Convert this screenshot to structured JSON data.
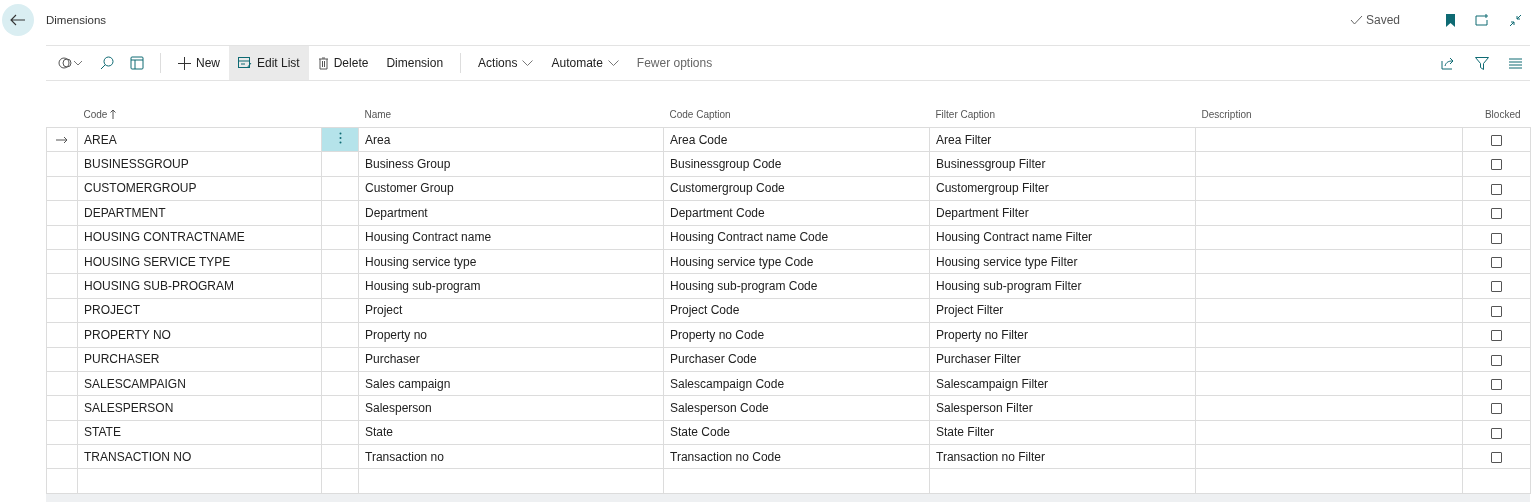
{
  "page": {
    "title": "Dimensions",
    "status": "Saved"
  },
  "toolbar": [
    {
      "label": "New",
      "kind": "new",
      "selected": false
    },
    {
      "label": "Edit List",
      "kind": "edit",
      "selected": true
    },
    {
      "label": "Delete",
      "kind": "delete",
      "selected": false
    },
    {
      "label": "Dimension",
      "kind": "plain",
      "selected": false
    },
    {
      "label": "Actions",
      "kind": "menu",
      "selected": false
    },
    {
      "label": "Automate",
      "kind": "menu",
      "selected": false
    },
    {
      "label": "Fewer options",
      "kind": "link",
      "selected": false
    }
  ],
  "table": {
    "columns": [
      "Code",
      "Name",
      "Code Caption",
      "Filter Caption",
      "Description",
      "Blocked"
    ],
    "rows": [
      {
        "code": "AREA",
        "name": "Area",
        "code_caption": "Area Code",
        "filter_caption": "Area Filter",
        "blocked": false,
        "selected": true
      },
      {
        "code": "BUSINESSGROUP",
        "name": "Business Group",
        "code_caption": "Businessgroup Code",
        "filter_caption": "Businessgroup Filter",
        "blocked": false,
        "selected": false
      },
      {
        "code": "CUSTOMERGROUP",
        "name": "Customer Group",
        "code_caption": "Customergroup Code",
        "filter_caption": "Customergroup Filter",
        "blocked": false,
        "selected": false
      },
      {
        "code": "DEPARTMENT",
        "name": "Department",
        "code_caption": "Department Code",
        "filter_caption": "Department Filter",
        "blocked": false,
        "selected": false
      },
      {
        "code": "HOUSING CONTRACTNAME",
        "name": "Housing Contract name",
        "code_caption": "Housing Contract name Code",
        "filter_caption": "Housing Contract name Filter",
        "blocked": false,
        "selected": false
      },
      {
        "code": "HOUSING SERVICE TYPE",
        "name": "Housing service type",
        "code_caption": "Housing service type Code",
        "filter_caption": "Housing service type Filter",
        "blocked": false,
        "selected": false
      },
      {
        "code": "HOUSING SUB-PROGRAM",
        "name": "Housing sub-program",
        "code_caption": "Housing sub-program Code",
        "filter_caption": "Housing sub-program Filter",
        "blocked": false,
        "selected": false
      },
      {
        "code": "PROJECT",
        "name": "Project",
        "code_caption": "Project Code",
        "filter_caption": "Project Filter",
        "blocked": false,
        "selected": false
      },
      {
        "code": "PROPERTY NO",
        "name": "Property no",
        "code_caption": "Property no Code",
        "filter_caption": "Property no Filter",
        "blocked": false,
        "selected": false
      },
      {
        "code": "PURCHASER",
        "name": "Purchaser",
        "code_caption": "Purchaser Code",
        "filter_caption": "Purchaser Filter",
        "blocked": false,
        "selected": false
      },
      {
        "code": "SALESCAMPAIGN",
        "name": "Sales campaign",
        "code_caption": "Salescampaign Code",
        "filter_caption": "Salescampaign Filter",
        "blocked": false,
        "selected": false
      },
      {
        "code": "SALESPERSON",
        "name": "Salesperson",
        "code_caption": "Salesperson Code",
        "filter_caption": "Salesperson Filter",
        "blocked": false,
        "selected": false
      },
      {
        "code": "STATE",
        "name": "State",
        "code_caption": "State Code",
        "filter_caption": "State Filter",
        "blocked": false,
        "selected": false
      },
      {
        "code": "TRANSACTION NO",
        "name": "Transaction no",
        "code_caption": "Transaction no Code",
        "filter_caption": "Transaction no Filter",
        "blocked": false,
        "selected": false
      }
    ]
  }
}
